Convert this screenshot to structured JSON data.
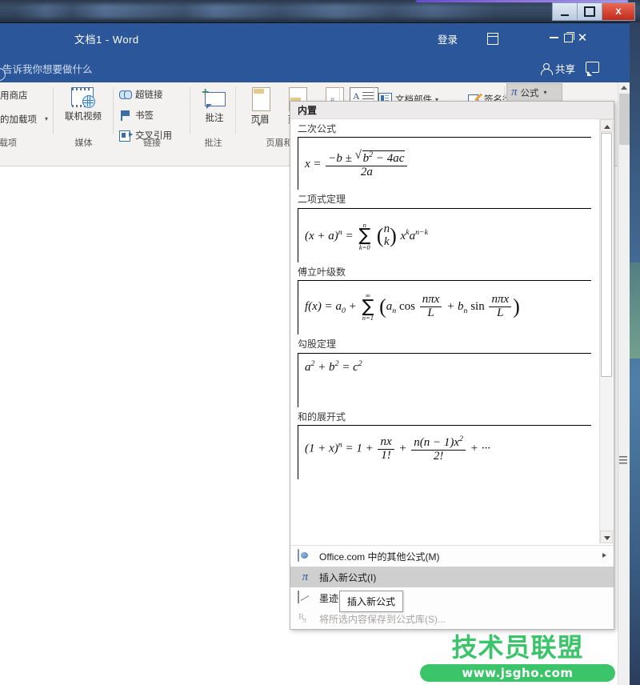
{
  "os_window": {
    "minimize_label": "–",
    "maximize_label": "□",
    "close_label": "X"
  },
  "word_window": {
    "document_title": "文档1  -  Word",
    "sign_in_label": "登录",
    "ribbon_display_icon": "ribbon-display-options-icon",
    "minimize_label": "",
    "restore_label": "",
    "close_label": "✕",
    "tell_me_placeholder": "告诉我你想要做什么",
    "share_label": "共享",
    "comment_icon": "comment-icon"
  },
  "ribbon": {
    "groups": [
      {
        "name": "addins",
        "label": "加载项",
        "items": [
          {
            "label": "用商店"
          },
          {
            "label": "的加载项",
            "caret": "▾"
          }
        ]
      },
      {
        "name": "media",
        "label": "媒体",
        "items": [
          {
            "label": "联机视频"
          }
        ]
      },
      {
        "name": "links",
        "label": "链接",
        "items": [
          {
            "label": "超链接"
          },
          {
            "label": "书签"
          },
          {
            "label": "交叉引用"
          }
        ]
      },
      {
        "name": "comments",
        "label": "批注",
        "items": [
          {
            "label": "批注"
          }
        ]
      },
      {
        "name": "header_footer",
        "label": "页眉和页脚",
        "items": [
          {
            "label": "页眉",
            "caret": "▾"
          },
          {
            "label": "页脚",
            "caret": "▾"
          },
          {
            "label": "",
            "caret": ""
          }
        ]
      },
      {
        "name": "text",
        "label": "",
        "items": [
          {
            "label": "文档部件",
            "caret": "▾"
          },
          {
            "label": "签名行",
            "caret": "▾"
          }
        ]
      }
    ],
    "equation_button": {
      "label": "公式",
      "symbol": "π",
      "caret": "▾",
      "active": true
    }
  },
  "equation_gallery": {
    "header": "内置",
    "entries": [
      {
        "caption": "二次公式",
        "name": "quadratic-formula"
      },
      {
        "caption": "二项式定理",
        "name": "binomial-theorem"
      },
      {
        "caption": "傅立叶级数",
        "name": "fourier-series"
      },
      {
        "caption": "勾股定理",
        "name": "pythagorean-theorem"
      },
      {
        "caption": "和的展开式",
        "name": "expansion-of-a-sum"
      }
    ],
    "menu_items": [
      {
        "label": "Office.com 中的其他公式(M)",
        "icon": "office-com-icon",
        "has_submenu": true,
        "selected": false,
        "disabled": false
      },
      {
        "label": "插入新公式(I)",
        "icon": "pi-icon",
        "has_submenu": false,
        "selected": true,
        "disabled": false
      },
      {
        "label": "墨迹公式(K)",
        "icon": "ink-equation-icon",
        "has_submenu": false,
        "selected": false,
        "disabled": false
      },
      {
        "label": "将所选内容保存到公式库(S)...",
        "icon": "save-to-gallery-icon",
        "has_submenu": false,
        "selected": false,
        "disabled": true
      }
    ],
    "scrollbar": {
      "up_arrow": "▲",
      "down_arrow": "▼"
    }
  },
  "tooltip": {
    "text": "插入新公式"
  },
  "watermark": {
    "title": "技术员联盟",
    "url": "www.jsgho.com",
    "color": "#3cc46a"
  },
  "colors": {
    "word_blue": "#2b579a",
    "ribbon_bg": "#f3f2f1",
    "accent_green": "#3cc46a"
  }
}
